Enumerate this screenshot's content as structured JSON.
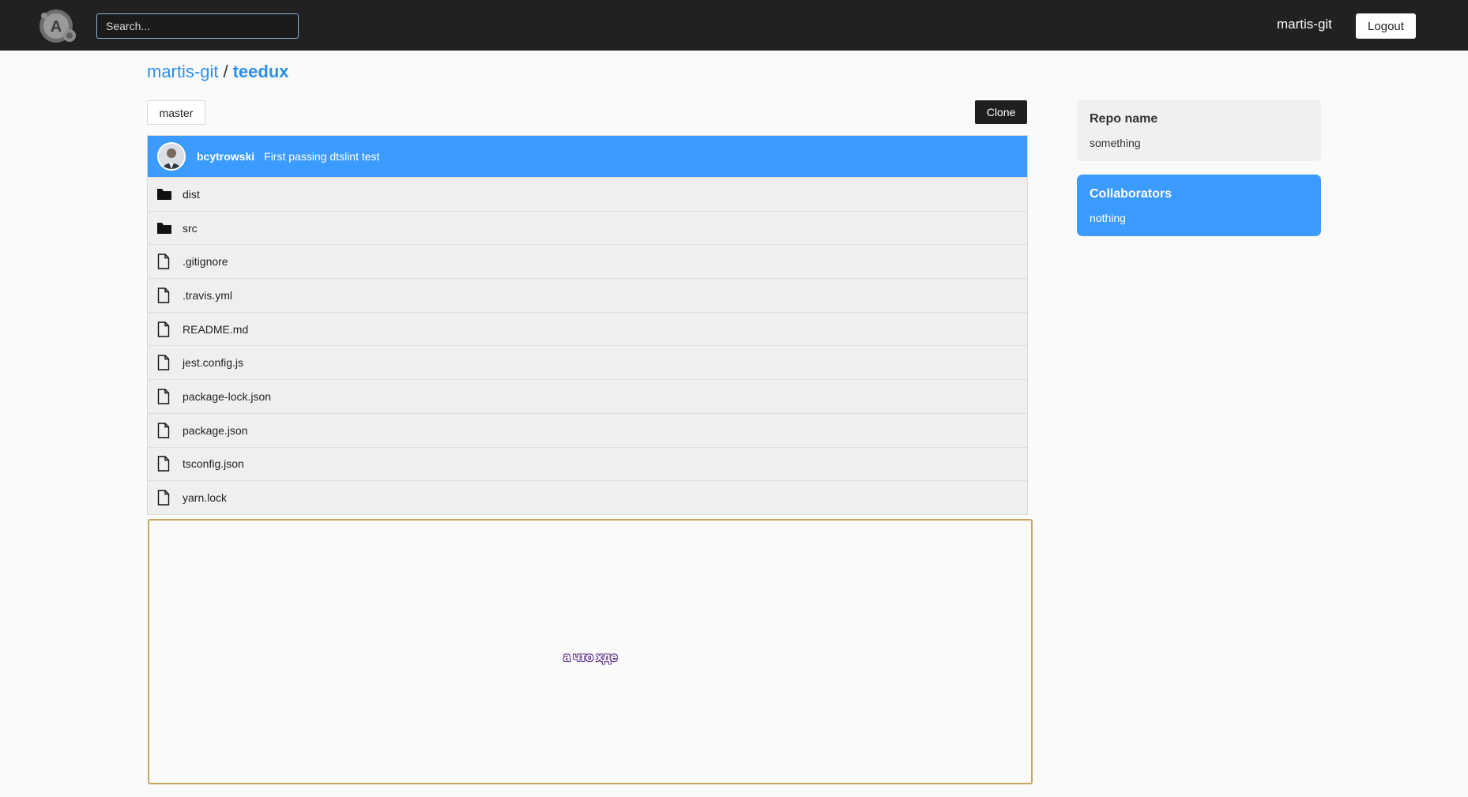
{
  "header": {
    "search_placeholder": "Search...",
    "username": "martis-git",
    "logout_label": "Logout"
  },
  "breadcrumb": {
    "owner": "martis-git",
    "separator": "/",
    "repo": "teedux"
  },
  "toolbar": {
    "branch": "master",
    "clone_label": "Clone"
  },
  "commit": {
    "author": "bcytrowski",
    "message": "First passing dtslint test"
  },
  "files": [
    {
      "name": "dist",
      "type": "folder"
    },
    {
      "name": "src",
      "type": "folder"
    },
    {
      "name": ".gitignore",
      "type": "file"
    },
    {
      "name": ".travis.yml",
      "type": "file"
    },
    {
      "name": "README.md",
      "type": "file"
    },
    {
      "name": "jest.config.js",
      "type": "file"
    },
    {
      "name": "package-lock.json",
      "type": "file"
    },
    {
      "name": "package.json",
      "type": "file"
    },
    {
      "name": "tsconfig.json",
      "type": "file"
    },
    {
      "name": "yarn.lock",
      "type": "file"
    }
  ],
  "preview": {
    "text": "а что хде"
  },
  "sidebar": {
    "repo_name": {
      "title": "Repo name",
      "value": "something"
    },
    "collaborators": {
      "title": "Collaborators",
      "value": "nothing"
    }
  },
  "colors": {
    "accent": "#3b9bff",
    "link": "#2d8fe6",
    "topbar": "#212121",
    "preview_border": "#c6a75b"
  }
}
